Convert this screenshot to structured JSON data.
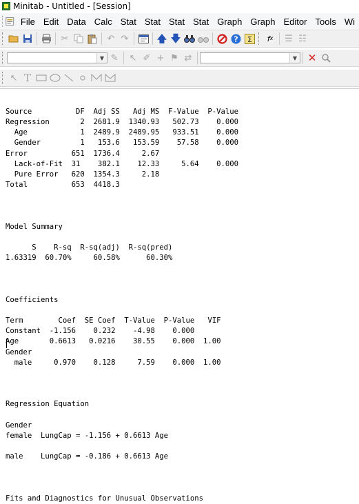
{
  "window": {
    "title": "Minitab - Untitled - [Session]"
  },
  "menu": [
    {
      "label": "File"
    },
    {
      "label": "Edit"
    },
    {
      "label": "Data"
    },
    {
      "label": "Calc"
    },
    {
      "label": "Stat"
    },
    {
      "label": "Stat"
    },
    {
      "label": "Stat"
    },
    {
      "label": "Stat"
    },
    {
      "label": "Graph"
    },
    {
      "label": "Graph"
    },
    {
      "label": "Editor"
    },
    {
      "label": "Tools"
    },
    {
      "label": "Wi"
    }
  ],
  "icons": {
    "toolbar1": [
      "open-folder-icon",
      "save-icon",
      "print-icon",
      "cut-icon",
      "copy-icon",
      "paste-icon",
      "undo-icon",
      "redo-icon",
      "session-window-icon",
      "arrow-up-icon",
      "arrow-down-icon",
      "find-icon",
      "find-next-icon",
      "cancel-icon",
      "help-icon",
      "sigma-icon",
      "fx-icon",
      "tree-icon",
      "tree2-icon"
    ],
    "toolbar2": [
      "worksheet-combo",
      "brush-icon",
      "pointer-icon",
      "pen-icon",
      "crosshair-icon",
      "flag-icon",
      "swap-icon",
      "column-combo",
      "delete-icon",
      "zoom-icon"
    ],
    "toolbar3": [
      "select-tool-icon",
      "text-tool-icon",
      "rectangle-tool-icon",
      "ellipse-tool-icon",
      "line-tool-icon",
      "marker-tool-icon",
      "polyline-tool-icon",
      "polygon-tool-icon"
    ]
  },
  "session": {
    "anova": {
      "header": "Source          DF  Adj SS   Adj MS  F-Value  P-Value",
      "rows": [
        "Regression       2  2681.9  1340.93   502.73    0.000",
        "  Age            1  2489.9  2489.95   933.51    0.000",
        "  Gender         1   153.6   153.59    57.58    0.000",
        "Error          651  1736.4     2.67",
        "  Lack-of-Fit  31    382.1    12.33     5.64    0.000",
        "  Pure Error   620  1354.3     2.18",
        "Total          653  4418.3"
      ]
    },
    "model_summary": {
      "title": "Model Summary",
      "header": "      S    R-sq  R-sq(adj)  R-sq(pred)",
      "row": "1.63319  60.70%     60.58%      60.30%"
    },
    "coefficients": {
      "title": "Coefficients",
      "header": "Term        Coef  SE Coef  T-Value  P-Value   VIF",
      "rows": [
        "Constant  -1.156    0.232    -4.98    0.000",
        "Age       0.6613   0.0216    30.55    0.000  1.00",
        "Gender",
        "  male     0.970    0.128     7.59    0.000  1.00"
      ]
    },
    "regression_equation": {
      "title": "Regression Equation",
      "group_label": "Gender",
      "female": "female  LungCap = -1.156 + 0.6613 Age",
      "male": "male    LungCap = -0.186 + 0.6613 Age"
    },
    "fits_title": "Fits and Diagnostics for Unusual Observations"
  }
}
